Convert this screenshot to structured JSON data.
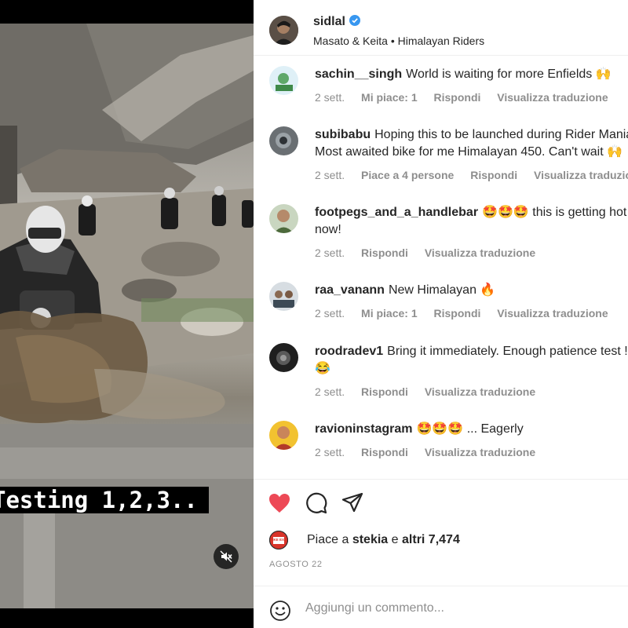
{
  "video": {
    "caption": "Testing 1,2,3..",
    "mute_icon": "muted-speaker-icon"
  },
  "post": {
    "username": "sidlal",
    "verified": true,
    "subtitle": "Masato & Keita • Himalayan Riders"
  },
  "comments": [
    {
      "user": "sachin__singh",
      "text": "World is waiting for more Enfields 🙌",
      "time": "2 sett.",
      "likes": "Mi piace: 1",
      "reply": "Rispondi",
      "translate": "Visualizza traduzione"
    },
    {
      "user": "subibabu",
      "text": "Hoping this to be launched during Rider Mania",
      "text2": "Most awaited bike for me Himalayan 450. Can't wait 🙌",
      "time": "2 sett.",
      "likes": "Piace a 4 persone",
      "reply": "Rispondi",
      "translate": "Visualizza traduzione"
    },
    {
      "user": "footpegs_and_a_handlebar",
      "text": "🤩🤩🤩 this is getting hot",
      "text2": "now!",
      "time": "2 sett.",
      "reply": "Rispondi",
      "translate": "Visualizza traduzione"
    },
    {
      "user": "raa_vanann",
      "text": "New Himalayan 🔥",
      "time": "2 sett.",
      "likes": "Mi piace: 1",
      "reply": "Rispondi",
      "translate": "Visualizza traduzione"
    },
    {
      "user": "roodradev1",
      "text": "Bring it immediately. Enough patience test !",
      "text2": "😂",
      "time": "2 sett.",
      "reply": "Rispondi",
      "translate": "Visualizza traduzione"
    },
    {
      "user": "ravioninstagram",
      "text": "🤩🤩🤩 ... Eagerly",
      "time": "2 sett.",
      "reply": "Rispondi",
      "translate": "Visualizza traduzione"
    }
  ],
  "actions": {
    "like_icon": "heart-filled-icon",
    "comment_icon": "comment-bubble-icon",
    "share_icon": "paper-plane-icon",
    "like_color": "#ed4956"
  },
  "likes": {
    "prefix": "Piace a",
    "user": "stekia",
    "connector": "e",
    "others": "altri 7,474",
    "avatar_text": "BIKE EXIF"
  },
  "date": "AGOSTO 22",
  "add_comment": {
    "placeholder": "Aggiungi un commento..."
  }
}
